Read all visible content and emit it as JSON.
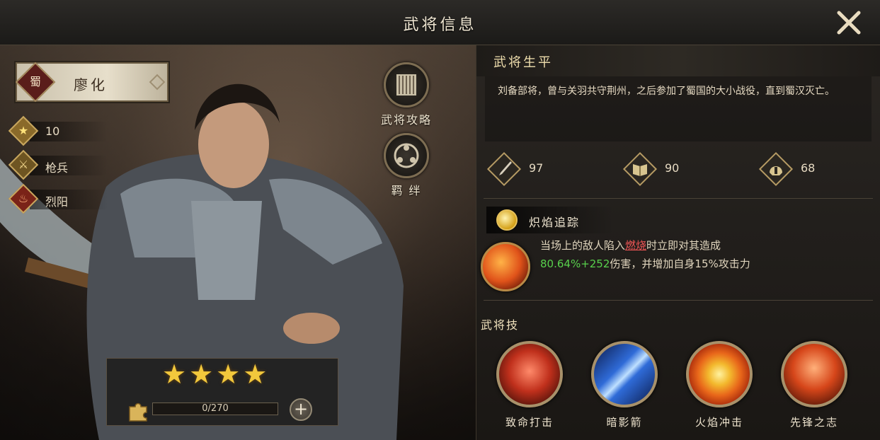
{
  "title": "武将信息",
  "hero": {
    "faction_glyph": "蜀",
    "name": "廖化",
    "level": "10",
    "troop_type": "枪兵",
    "element": "烈阳"
  },
  "side_buttons": {
    "guide_label": "武将攻略",
    "bond_label": "羁 绊"
  },
  "stars": "★★★★",
  "fragments": {
    "text": "0/270",
    "current": 0,
    "required": 270
  },
  "bio": {
    "title": "武将生平",
    "text": "刘备部将，曾与关羽共守荆州，之后参加了蜀国的大小战役，直到蜀汉灭亡。"
  },
  "stats": [
    {
      "icon": "sword-icon",
      "value": "97"
    },
    {
      "icon": "book-icon",
      "value": "90"
    },
    {
      "icon": "helmet-icon",
      "value": "68"
    }
  ],
  "talent": {
    "name": "炽焰追踪",
    "desc_prefix": "当场上的敌人陷入",
    "desc_keyword": "燃烧",
    "desc_mid": "时立即对其造成",
    "desc_value": "80.64%+252",
    "desc_suffix": "伤害，并增加自身15%攻击力"
  },
  "skills_label": "武将技",
  "skills": [
    {
      "name": "致命打击",
      "color": "#c0301c"
    },
    {
      "name": "暗影箭",
      "color": "#2f6bd8"
    },
    {
      "name": "火焰冲击",
      "color": "#e8861a"
    },
    {
      "name": "先锋之志",
      "color": "#d6461a"
    }
  ]
}
